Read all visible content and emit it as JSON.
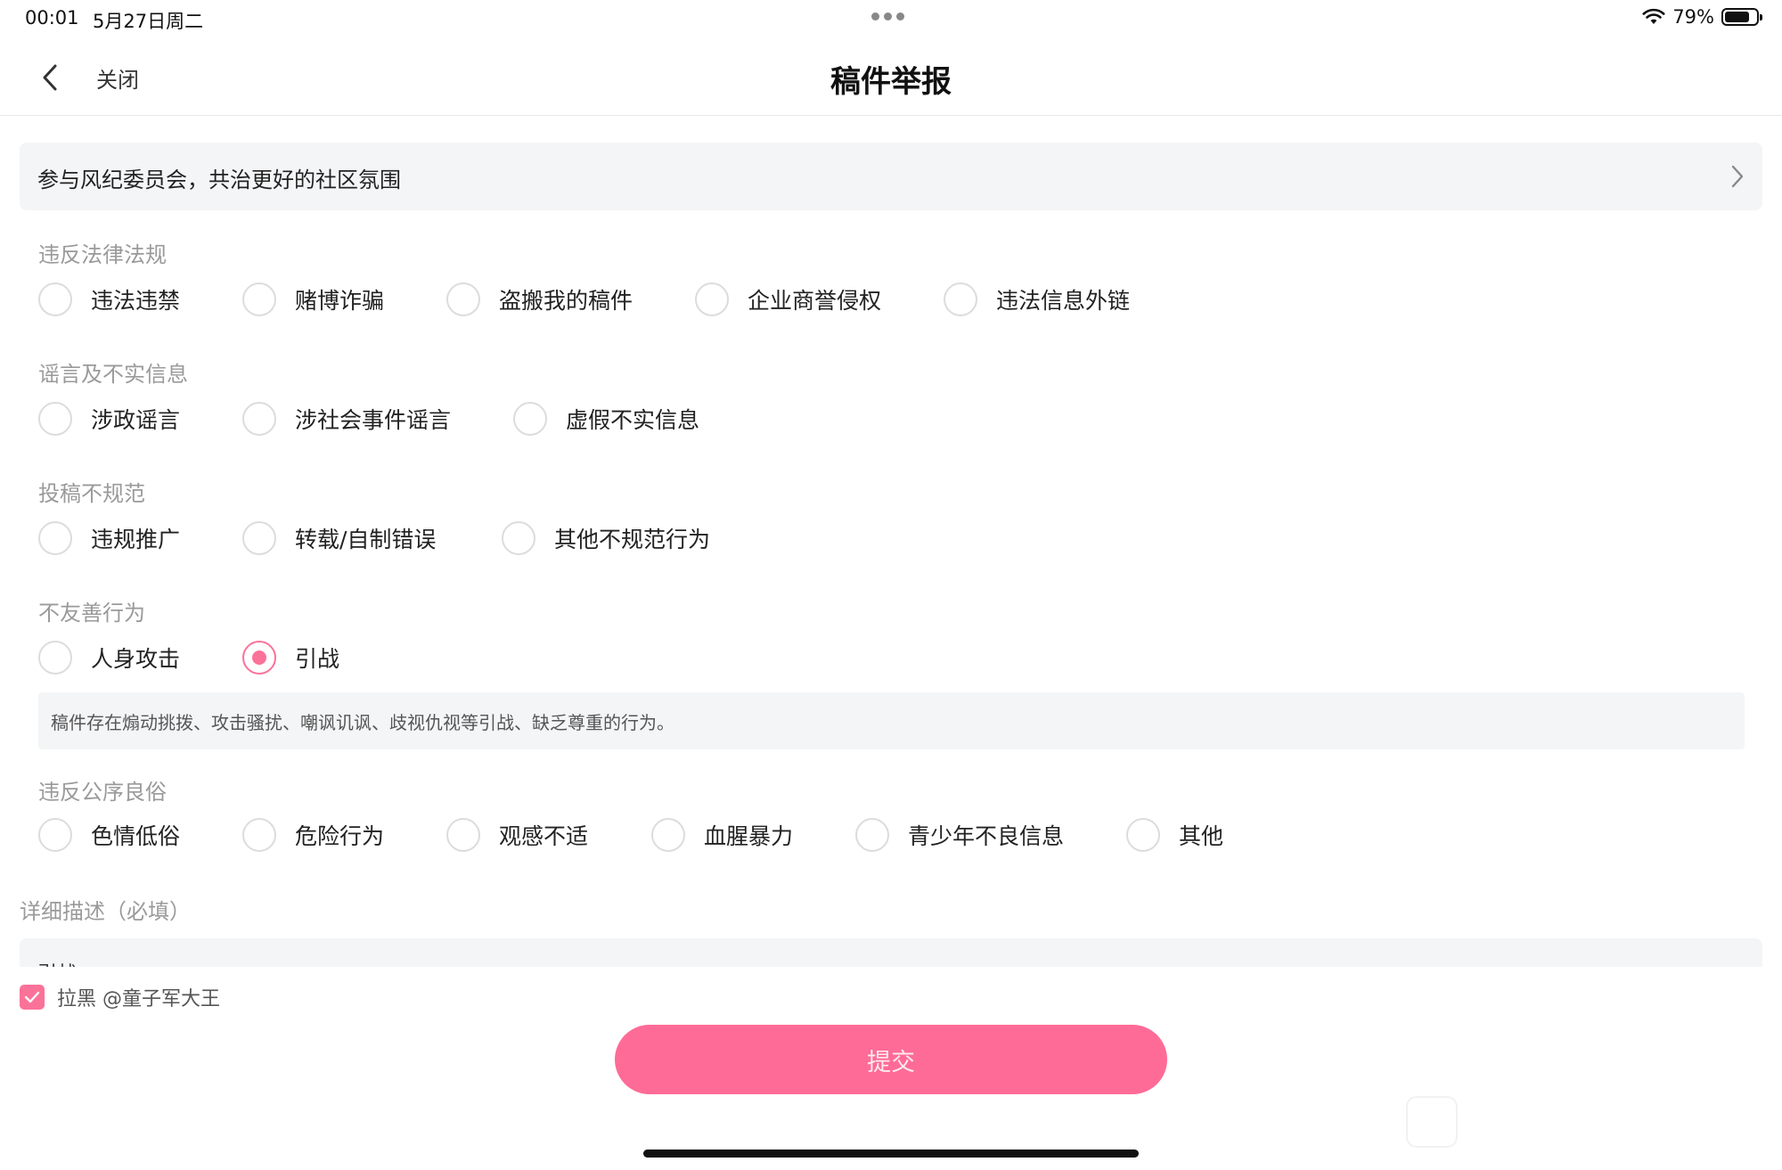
{
  "status_bar": {
    "time": "00:01",
    "date": "5月27日周二",
    "battery": "79%",
    "battery_level": 0.79
  },
  "nav": {
    "close": "关闭",
    "title": "稿件举报"
  },
  "banner": {
    "text": "参与风纪委员会，共治更好的社区氛围"
  },
  "sections": [
    {
      "title": "违反法律法规",
      "options": [
        "违法违禁",
        "赌博诈骗",
        "盗搬我的稿件",
        "企业商誉侵权",
        "违法信息外链"
      ]
    },
    {
      "title": "谣言及不实信息",
      "options": [
        "涉政谣言",
        "涉社会事件谣言",
        "虚假不实信息"
      ]
    },
    {
      "title": "投稿不规范",
      "options": [
        "违规推广",
        "转载/自制错误",
        "其他不规范行为"
      ]
    },
    {
      "title": "不友善行为",
      "options": [
        "人身攻击",
        "引战"
      ]
    },
    {
      "title": "违反公序良俗",
      "options": [
        "色情低俗",
        "危险行为",
        "观感不适",
        "血腥暴力",
        "青少年不良信息",
        "其他"
      ]
    }
  ],
  "selected_option": "引战",
  "selected_description": "稿件存在煽动挑拨、攻击骚扰、嘲讽讥讽、歧视仇视等引战、缺乏尊重的行为。",
  "detail": {
    "title": "详细描述（必填）",
    "value": "引战"
  },
  "block_user": {
    "label": "拉黑 @童子军大王",
    "checked": true
  },
  "submit": {
    "label": "提交"
  },
  "colors": {
    "accent": "#fb7299",
    "submit_bg": "#fe6b97",
    "muted_text": "#9a9a9a",
    "panel_bg": "#f4f5f7"
  }
}
